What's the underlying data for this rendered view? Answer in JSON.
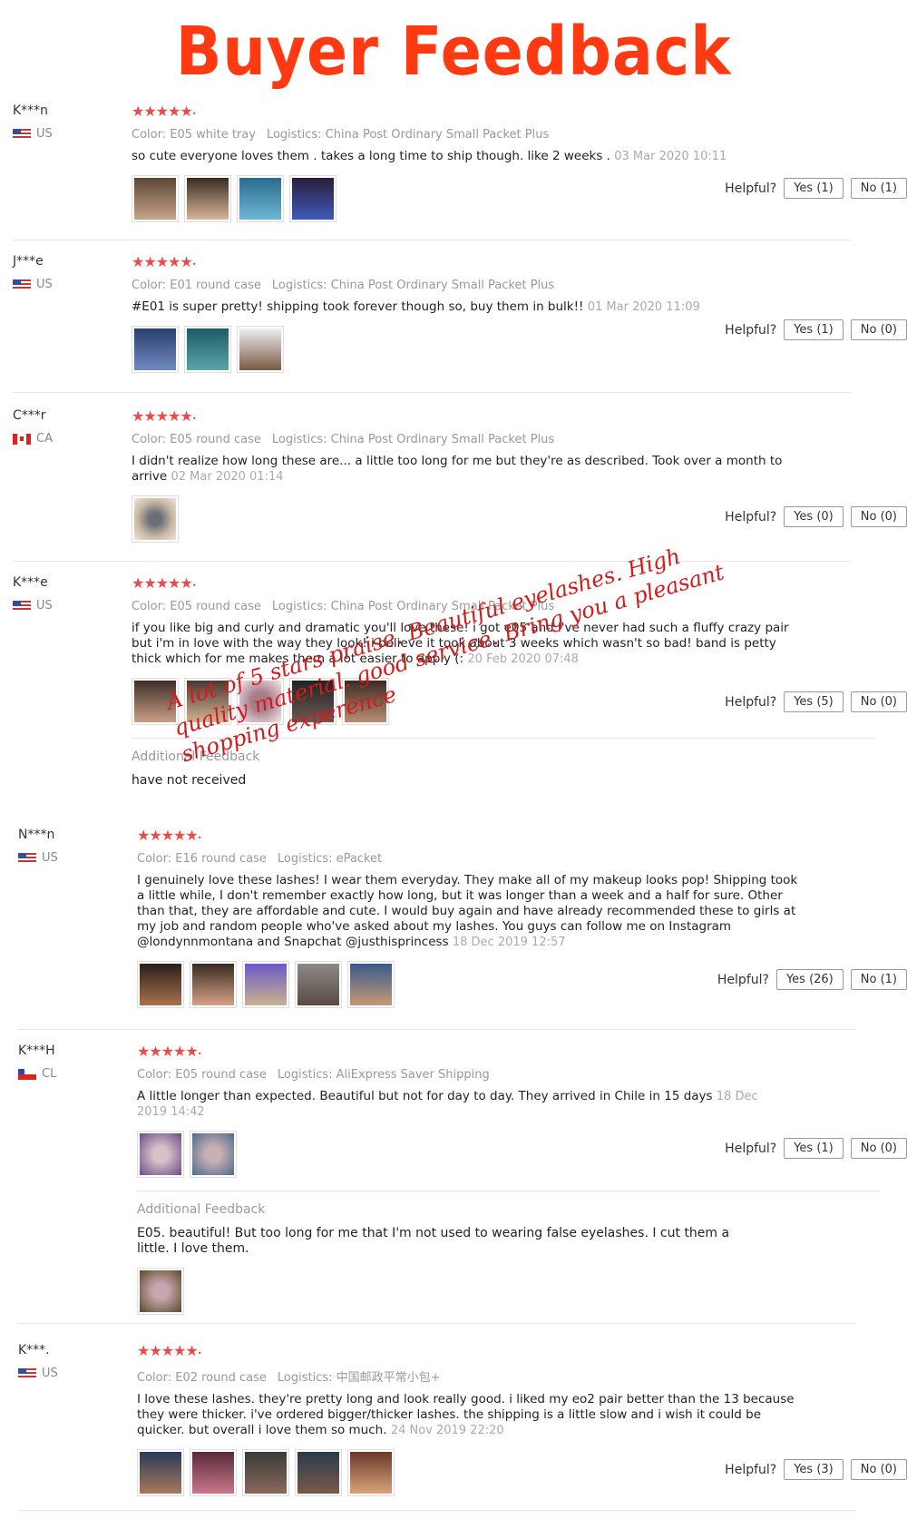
{
  "title": "Buyer Feedback",
  "overlay_text": "A lot of 5 stars praise. Beautiful eyelashes. High quality material. good service. Bring you a pleasant shopping experënce",
  "helpful_label": "Helpful?",
  "additional_label": "Additional Feedback",
  "reviews": [
    {
      "user": "K***n",
      "country": "US",
      "color": "Color: E05 white tray",
      "logistics": "Logistics: China Post Ordinary Small Packet Plus",
      "text": "so cute everyone loves them . takes a long time to ship though. like 2 weeks .",
      "date": "03 Mar 2020 10:11",
      "yes": "Yes (1)",
      "no": "No (1)"
    },
    {
      "user": "J***e",
      "country": "US",
      "color": "Color: E01 round case",
      "logistics": "Logistics: China Post Ordinary Small Packet Plus",
      "text": "#E01 is super pretty! shipping took forever though so, buy them in bulk!!",
      "date": "01 Mar 2020 11:09",
      "yes": "Yes (1)",
      "no": "No (0)"
    },
    {
      "user": "C***r",
      "country": "CA",
      "color": "Color: E05 round case",
      "logistics": "Logistics: China Post Ordinary Small Packet Plus",
      "text": "I didn't realize how long these are... a little too long for me but they're as described. Took over a month to arrive",
      "date": "02 Mar 2020 01:14",
      "yes": "Yes (0)",
      "no": "No (0)"
    },
    {
      "user": "K***e",
      "country": "US",
      "color": "Color: E05 round case",
      "logistics": "Logistics: China Post Ordinary Small Packet Plus",
      "text": "if you like big and curly and dramatic you'll love these! i got e05 and i've never had such a fluffy crazy pair but i'm in love with the way they look! i believe it took about 3 weeks which wasn't so bad! band is petty thick which for me makes them a lot easier to apply (:",
      "date": "20 Feb 2020 07:48",
      "yes": "Yes (5)",
      "no": "No (0)",
      "additional": "have not received"
    },
    {
      "user": "N***n",
      "country": "US",
      "color": "Color: E16 round case",
      "logistics": "Logistics: ePacket",
      "text": "I genuinely love these lashes! I wear them everyday. They make all of my makeup looks pop! Shipping took a little while, I don't remember exactly how long, but it was longer than a week and a half for sure. Other than that, they are affordable and cute. I would buy again and have already recommended these to girls at my job and random people who've asked about my lashes. You guys can follow me on Instagram @londynnmontana and Snapchat @justhisprincess",
      "date": "18 Dec 2019 12:57",
      "yes": "Yes (26)",
      "no": "No (1)"
    },
    {
      "user": "K***H",
      "country": "CL",
      "color": "Color: E05 round case",
      "logistics": "Logistics: AliExpress Saver Shipping",
      "text": "A little longer than expected. Beautiful but not for day to day. They arrived in Chile in 15 days",
      "date": "18 Dec 2019 14:42",
      "yes": "Yes (1)",
      "no": "No (0)",
      "additional": "E05. beautiful! But too long for me that I'm not used to wearing false eyelashes. I cut them a little. I love them."
    },
    {
      "user": "K***.",
      "country": "US",
      "color": "Color: E02 round case",
      "logistics": "Logistics: 中国邮政平常小包+",
      "text": "I love these lashes. they're pretty long and look really good. i liked my eo2 pair better than the 13 because they were thicker. i've ordered bigger/thicker lashes. the shipping is a little slow and i wish it could be quicker. but overall i love them so much.",
      "date": "24 Nov 2019 22:20",
      "yes": "Yes (3)",
      "no": "No (0)"
    }
  ]
}
